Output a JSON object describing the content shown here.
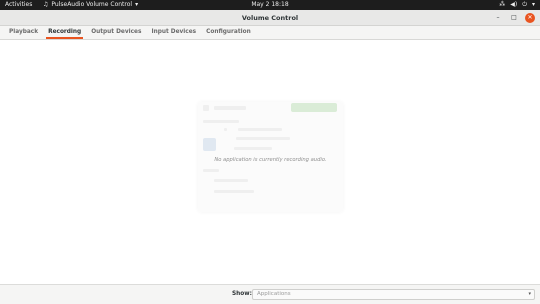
{
  "topbar": {
    "activities": "Activities",
    "app_name": "PulseAudio Volume Control",
    "clock": "May 2  18:18"
  },
  "window": {
    "title": "Volume Control",
    "close_label": "✕",
    "minimize_label": "–",
    "maximize_label": "□"
  },
  "tabs": [
    {
      "label": "Playback"
    },
    {
      "label": "Recording"
    },
    {
      "label": "Output Devices"
    },
    {
      "label": "Input Devices"
    },
    {
      "label": "Configuration"
    }
  ],
  "main": {
    "empty_message": "No application is currently recording audio."
  },
  "bottom": {
    "show_label": "Show:",
    "show_value": "Applications"
  },
  "colors": {
    "accent": "#e95420",
    "topbar_bg": "#1d1d1d"
  }
}
